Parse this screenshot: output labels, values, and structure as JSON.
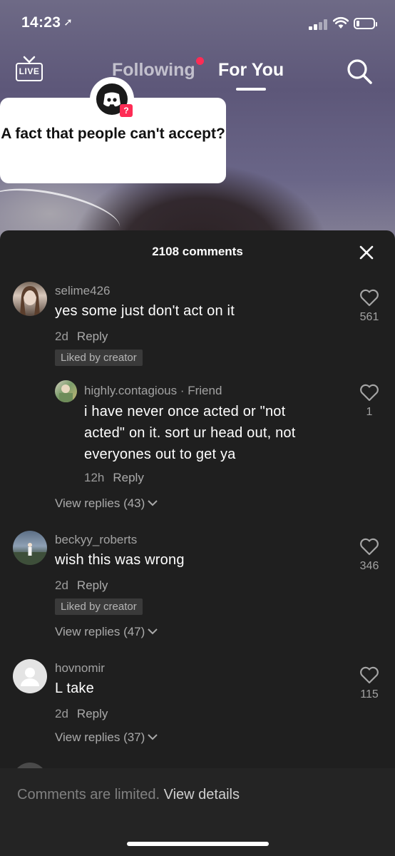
{
  "status_bar": {
    "time": "14:23",
    "location_icon": "location-arrow-icon",
    "battery_level": 0.2
  },
  "top_nav": {
    "live_label": "LIVE",
    "tabs": [
      {
        "label": "Following",
        "active": false,
        "has_notification_dot": true
      },
      {
        "label": "For You",
        "active": true
      }
    ],
    "search_icon": "search-icon"
  },
  "video": {
    "question_sticker": {
      "text": "A fact that people can't accept?",
      "badge": "?"
    }
  },
  "comments_sheet": {
    "title": "2108 comments",
    "close_icon": "close-icon",
    "comments": [
      {
        "username": "selime426",
        "text": "yes some just don't act on it",
        "age": "2d",
        "reply_label": "Reply",
        "liked_by_creator": "Liked by creator",
        "likes": "561",
        "replies": [
          {
            "username": "highly.contagious",
            "tag": "Friend",
            "text": "i have never once acted or \"not acted\" on it. sort ur head out, not everyones out to get ya",
            "age": "12h",
            "reply_label": "Reply",
            "likes": "1"
          }
        ],
        "view_replies": "View replies (43)"
      },
      {
        "username": "beckyy_roberts",
        "text": "wish this was wrong",
        "age": "2d",
        "reply_label": "Reply",
        "liked_by_creator": "Liked by creator",
        "likes": "346",
        "view_replies": "View replies (47)"
      },
      {
        "username": "hovnomir",
        "text": "L take",
        "age": "2d",
        "reply_label": "Reply",
        "likes": "115",
        "view_replies": "View replies (37)"
      }
    ]
  },
  "bottom_bar": {
    "limited_text": "Comments are limited.",
    "link_text": "View details"
  },
  "colors": {
    "accent": "#fe2c55",
    "sheet_bg": "#1f1f1f",
    "badge_bg": "#3a3a3a"
  }
}
